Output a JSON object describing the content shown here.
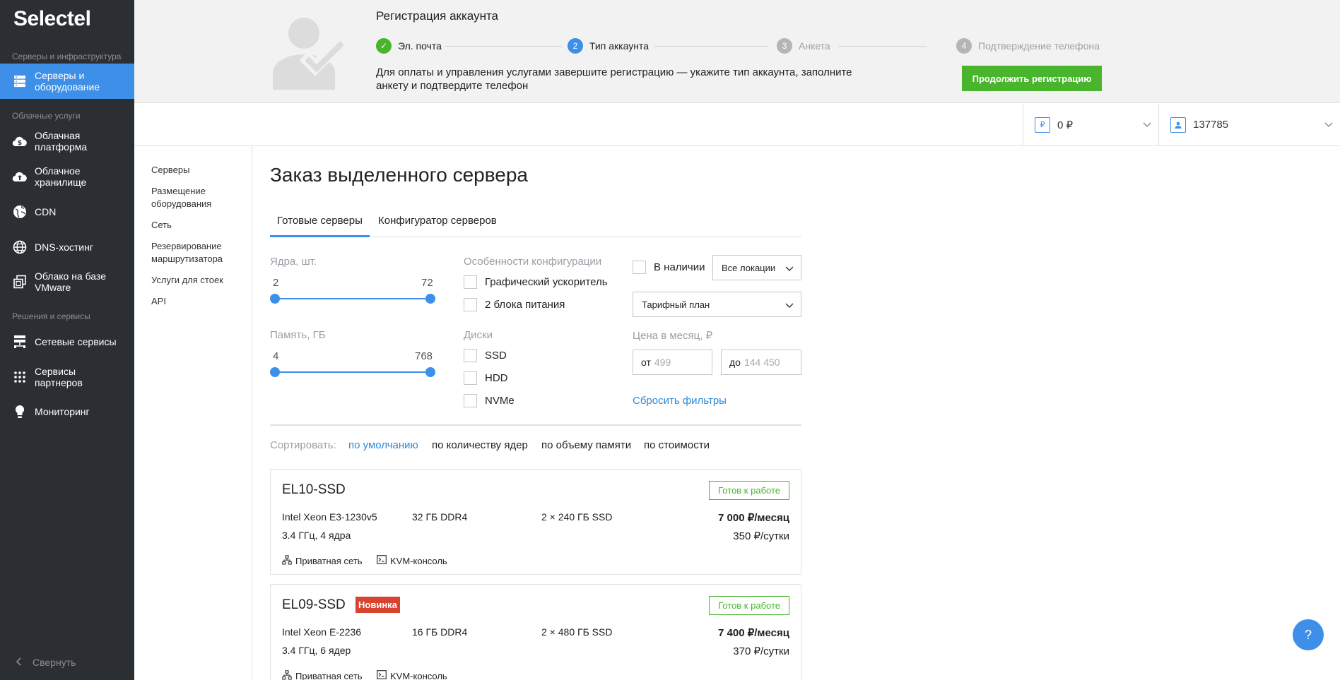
{
  "sidebar": {
    "logo": "Selectel",
    "sections": [
      "Серверы и инфраструктура",
      "Облачные услуги",
      "Решения и сервисы"
    ],
    "items": [
      {
        "label": "Серверы и оборудование",
        "icon": "server-icon"
      },
      {
        "label": "Облачная платформа",
        "icon": "cloud-dollar-icon"
      },
      {
        "label": "Облачное хранилище",
        "icon": "cloud-upload-icon"
      },
      {
        "label": "CDN",
        "icon": "globe-icon"
      },
      {
        "label": "DNS-хостинг",
        "icon": "globe-grid-icon"
      },
      {
        "label": "Облако на базе VMware",
        "icon": "copy-icon"
      },
      {
        "label": "Сетевые сервисы",
        "icon": "network-icon"
      },
      {
        "label": "Сервисы партнеров",
        "icon": "grid-icon"
      },
      {
        "label": "Мониторинг",
        "icon": "bulb-icon"
      }
    ],
    "collapse": "Свернуть"
  },
  "banner": {
    "title": "Регистрация аккаунта",
    "steps": [
      {
        "num": "✓",
        "label": "Эл. почта"
      },
      {
        "num": "2",
        "label": "Тип аккаунта"
      },
      {
        "num": "3",
        "label": "Анкета"
      },
      {
        "num": "4",
        "label": "Подтверждение телефона"
      }
    ],
    "text": "Для оплаты и управления услугами завершите регистрацию — укажите тип аккаунта, заполните анкету и подтвердите телефон",
    "button": "Продолжить регистрацию",
    "colors": {
      "done": "#48b52d",
      "active": "#3d8fe8",
      "pending": "#b5b5b5"
    }
  },
  "topbar": {
    "balance_icon": "₽",
    "balance": "0 ₽",
    "account": "137785"
  },
  "subnav": [
    "Серверы",
    "Размещение оборудования",
    "Сеть",
    "Резервирование маршрутизатора",
    "Услуги для стоек",
    "API"
  ],
  "main": {
    "title": "Заказ выделенного сервера",
    "tabs": [
      "Готовые серверы",
      "Конфигуратор серверов"
    ],
    "filters": {
      "cores_label": "Ядра, шт.",
      "cores_min": "2",
      "cores_max": "72",
      "memory_label": "Память, ГБ",
      "memory_min": "4",
      "memory_max": "768",
      "config_label": "Особенности конфигурации",
      "config_options": [
        "Графический ускоритель",
        "2 блока питания"
      ],
      "disks_label": "Диски",
      "disk_options": [
        "SSD",
        "HDD",
        "NVMe"
      ],
      "in_stock": "В наличии",
      "location": "Все локации",
      "plan": "Тарифный план",
      "price_label": "Цена в месяц, ₽",
      "price_from_prefix": "от",
      "price_from_placeholder": "499",
      "price_to_prefix": "до",
      "price_to_placeholder": "144 450",
      "reset": "Сбросить фильтры"
    },
    "sort": {
      "label": "Сортировать:",
      "options": [
        "по умолчанию",
        "по количеству ядер",
        "по объему памяти",
        "по стоимости"
      ]
    },
    "servers": [
      {
        "name": "EL10-SSD",
        "badge_new": "",
        "status": "Готов к работе",
        "cpu": "Intel Xeon E3-1230v5",
        "cpu_detail": "3.4 ГГц, 4 ядра",
        "ram": "32 ГБ DDR4",
        "disk": "2 × 240 ГБ SSD",
        "price_month": "7 000 ₽/месяц",
        "price_day": "350 ₽/сутки",
        "features": [
          "Приватная сеть",
          "KVM-консоль"
        ]
      },
      {
        "name": "EL09-SSD",
        "badge_new": "Новинка",
        "status": "Готов к работе",
        "cpu": "Intel Xeon E-2236",
        "cpu_detail": "3.4 ГГц, 6 ядер",
        "ram": "16 ГБ DDR4",
        "disk": "2 × 480 ГБ SSD",
        "price_month": "7 400 ₽/месяц",
        "price_day": "370 ₽/сутки",
        "features": [
          "Приватная сеть",
          "KVM-консоль"
        ]
      }
    ]
  },
  "help": "?"
}
